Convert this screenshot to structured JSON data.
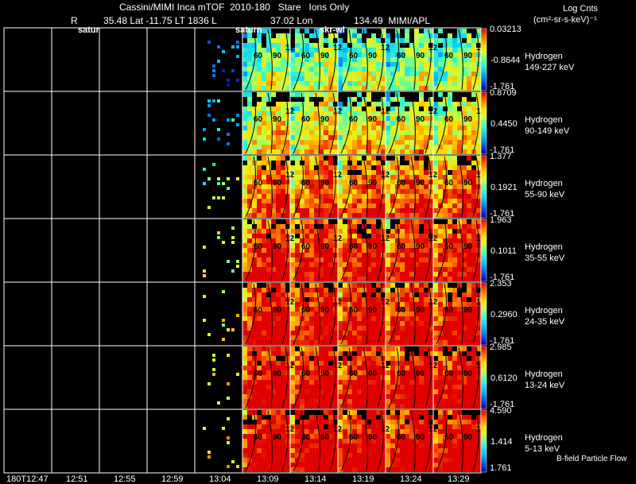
{
  "header": {
    "title": "Cassini/MIMI Inca mTOF  2010-180   Stare   Ions Only",
    "r_label": "R",
    "position": "35.48 Lat -11.75 LT 1836 L",
    "lon": "37.02 Lon",
    "value_apl": "134.49  MIMI/APL",
    "colorbar_title": "Log Cnts",
    "colorbar_units": "(cm²-sr-s-keV)⁻¹",
    "overlay_labels": [
      "satur",
      "saturn",
      "skr-wl"
    ]
  },
  "footer_note": "B-field Particle Flow",
  "chart_data": {
    "type": "heatmap",
    "title": "Cassini/MIMI Inca mTOF  2010-180   Stare   Ions Only",
    "x_tick_labels": [
      "180T12:47",
      "12:51",
      "12:55",
      "12:59",
      "13:04",
      "13:09",
      "13:14",
      "13:19",
      "13:24",
      "13:29"
    ],
    "contour_labels": [
      "60",
      "90",
      "12"
    ],
    "colors": {
      "low": "#0000c8",
      "mid": "#00ffff",
      "high": "#ff0000",
      "missing": "#000000"
    },
    "panels": [
      {
        "species": "Hydrogen",
        "energy": "149-227 keV",
        "cb_max": "0.03213",
        "cb_mid": "-0.8644",
        "cb_min": "-1.761",
        "mean_level": 0.32
      },
      {
        "species": "Hydrogen",
        "energy": "90-149 keV",
        "cb_max": "0.8709",
        "cb_mid": "0.4450",
        "cb_min": "-1.761",
        "mean_level": 0.45
      },
      {
        "species": "Hydrogen",
        "energy": "55-90 keV",
        "cb_max": "1.377",
        "cb_mid": "0.1921",
        "cb_min": "-1.761",
        "mean_level": 0.66
      },
      {
        "species": "Hydrogen",
        "energy": "35-55 keV",
        "cb_max": "1.963",
        "cb_mid": "0.1011",
        "cb_min": "-1.761",
        "mean_level": 0.76
      },
      {
        "species": "Hydrogen",
        "energy": "24-35 keV",
        "cb_max": "2.353",
        "cb_mid": "0.2960",
        "cb_min": "-1.761",
        "mean_level": 0.8
      },
      {
        "species": "Hydrogen",
        "energy": "13-24 keV",
        "cb_max": "2.985",
        "cb_mid": "0.6120",
        "cb_min": "-1.761",
        "mean_level": 0.83
      },
      {
        "species": "Hydrogen",
        "energy": "5-13 keV",
        "cb_max": "4.590",
        "cb_mid": "1.414",
        "cb_min": "1.761",
        "mean_level": 0.85
      }
    ]
  }
}
